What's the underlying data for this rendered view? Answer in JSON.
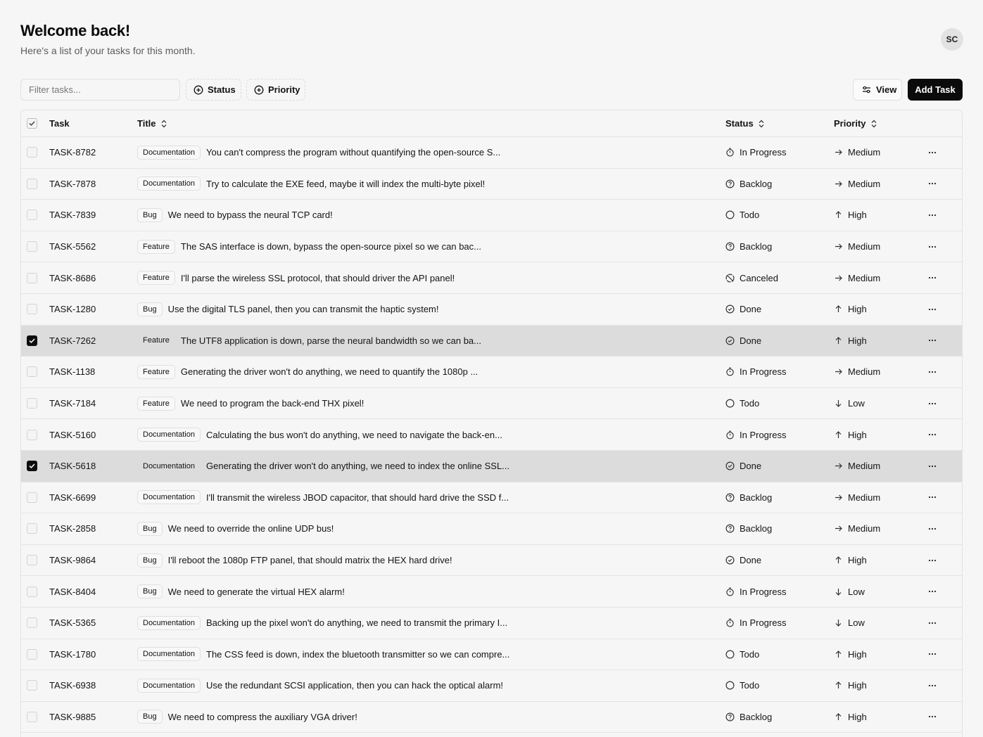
{
  "header": {
    "title": "Welcome back!",
    "subtitle": "Here's a list of your tasks for this month.",
    "avatar": "SC"
  },
  "toolbar": {
    "filter_placeholder": "Filter tasks...",
    "status_label": "Status",
    "priority_label": "Priority",
    "view_label": "View",
    "add_label": "Add Task"
  },
  "columns": {
    "task": "Task",
    "title": "Title",
    "status": "Status",
    "priority": "Priority"
  },
  "rows": [
    {
      "id": "TASK-8782",
      "label": "Documentation",
      "title": "You can't compress the program without quantifying the open-source S...",
      "status": "In Progress",
      "priority": "Medium",
      "selected": false
    },
    {
      "id": "TASK-7878",
      "label": "Documentation",
      "title": "Try to calculate the EXE feed, maybe it will index the multi-byte pixel!",
      "status": "Backlog",
      "priority": "Medium",
      "selected": false
    },
    {
      "id": "TASK-7839",
      "label": "Bug",
      "title": "We need to bypass the neural TCP card!",
      "status": "Todo",
      "priority": "High",
      "selected": false
    },
    {
      "id": "TASK-5562",
      "label": "Feature",
      "title": "The SAS interface is down, bypass the open-source pixel so we can bac...",
      "status": "Backlog",
      "priority": "Medium",
      "selected": false
    },
    {
      "id": "TASK-8686",
      "label": "Feature",
      "title": "I'll parse the wireless SSL protocol, that should driver the API panel!",
      "status": "Canceled",
      "priority": "Medium",
      "selected": false
    },
    {
      "id": "TASK-1280",
      "label": "Bug",
      "title": "Use the digital TLS panel, then you can transmit the haptic system!",
      "status": "Done",
      "priority": "High",
      "selected": false
    },
    {
      "id": "TASK-7262",
      "label": "Feature",
      "title": "The UTF8 application is down, parse the neural bandwidth so we can ba...",
      "status": "Done",
      "priority": "High",
      "selected": true
    },
    {
      "id": "TASK-1138",
      "label": "Feature",
      "title": "Generating the driver won't do anything, we need to quantify the 1080p ...",
      "status": "In Progress",
      "priority": "Medium",
      "selected": false
    },
    {
      "id": "TASK-7184",
      "label": "Feature",
      "title": "We need to program the back-end THX pixel!",
      "status": "Todo",
      "priority": "Low",
      "selected": false
    },
    {
      "id": "TASK-5160",
      "label": "Documentation",
      "title": "Calculating the bus won't do anything, we need to navigate the back-en...",
      "status": "In Progress",
      "priority": "High",
      "selected": false
    },
    {
      "id": "TASK-5618",
      "label": "Documentation",
      "title": "Generating the driver won't do anything, we need to index the online SSL...",
      "status": "Done",
      "priority": "Medium",
      "selected": true
    },
    {
      "id": "TASK-6699",
      "label": "Documentation",
      "title": "I'll transmit the wireless JBOD capacitor, that should hard drive the SSD f...",
      "status": "Backlog",
      "priority": "Medium",
      "selected": false
    },
    {
      "id": "TASK-2858",
      "label": "Bug",
      "title": "We need to override the online UDP bus!",
      "status": "Backlog",
      "priority": "Medium",
      "selected": false
    },
    {
      "id": "TASK-9864",
      "label": "Bug",
      "title": "I'll reboot the 1080p FTP panel, that should matrix the HEX hard drive!",
      "status": "Done",
      "priority": "High",
      "selected": false
    },
    {
      "id": "TASK-8404",
      "label": "Bug",
      "title": "We need to generate the virtual HEX alarm!",
      "status": "In Progress",
      "priority": "Low",
      "selected": false
    },
    {
      "id": "TASK-5365",
      "label": "Documentation",
      "title": "Backing up the pixel won't do anything, we need to transmit the primary I...",
      "status": "In Progress",
      "priority": "Low",
      "selected": false
    },
    {
      "id": "TASK-1780",
      "label": "Documentation",
      "title": "The CSS feed is down, index the bluetooth transmitter so we can compre...",
      "status": "Todo",
      "priority": "High",
      "selected": false
    },
    {
      "id": "TASK-6938",
      "label": "Documentation",
      "title": "Use the redundant SCSI application, then you can hack the optical alarm!",
      "status": "Todo",
      "priority": "High",
      "selected": false
    },
    {
      "id": "TASK-9885",
      "label": "Bug",
      "title": "We need to compress the auxiliary VGA driver!",
      "status": "Backlog",
      "priority": "High",
      "selected": false
    }
  ]
}
